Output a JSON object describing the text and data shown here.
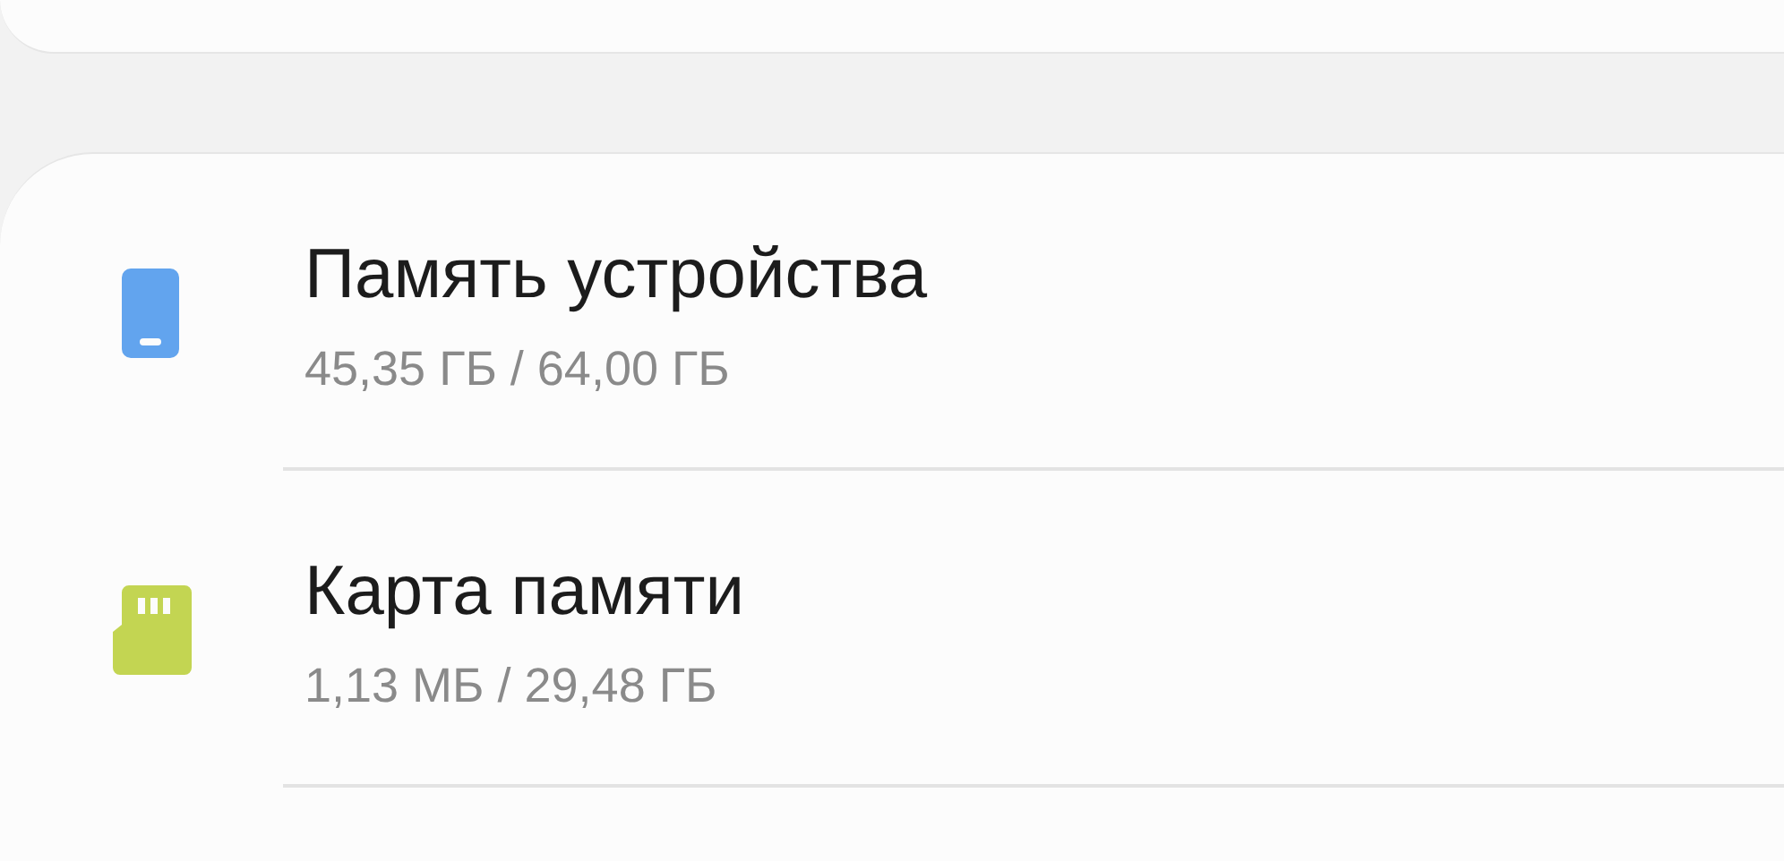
{
  "storage_items": [
    {
      "kind": "phone",
      "color": "#62a4ee",
      "title": "Память устройства",
      "usage": "45,35 ГБ / 64,00 ГБ"
    },
    {
      "kind": "sd-card",
      "color": "#c3d552",
      "title": "Карта памяти",
      "usage": "1,13 МБ / 29,48 ГБ"
    }
  ]
}
